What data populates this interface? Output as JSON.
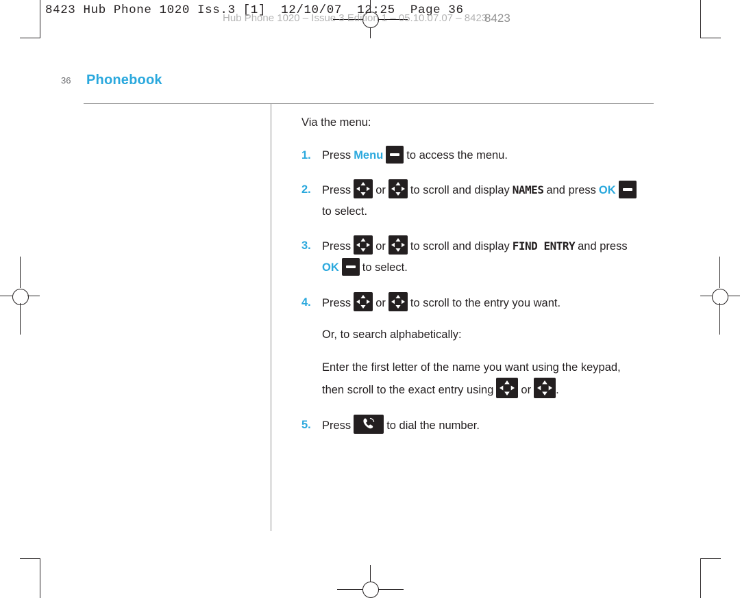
{
  "slug": {
    "text": "8423 Hub Phone 1020 Iss.3 [1]  12/10/07  12:25  Page 36"
  },
  "ghost": {
    "header": "Hub Phone 1020 – Issue 3 Edition 1 – 05.10.07.07 – 8423",
    "folio": "8423"
  },
  "page": {
    "number": "36",
    "chapter": "Phonebook"
  },
  "body": {
    "intro": "Via the menu:",
    "steps": [
      {
        "num": "1.",
        "before": "Press",
        "key_label": "Menu",
        "after": "to access the menu."
      },
      {
        "num": "2.",
        "before": "Press",
        "or": "or",
        "mid": "to scroll and display",
        "display": "NAMES",
        "and_press": "and press",
        "ok": "OK",
        "after": "to select."
      },
      {
        "num": "3.",
        "before": "Press",
        "or": "or",
        "mid": "to scroll and display",
        "display": "FIND ENTRY",
        "and_press": "and press",
        "ok": "OK",
        "after": "to select."
      },
      {
        "num": "4.",
        "before": "Press",
        "or": "or",
        "after": "to scroll to the entry you want."
      },
      {
        "num": "5.",
        "before": "Press",
        "after": "to dial the number."
      }
    ],
    "alt_intro": "Or, to search alphabetically:",
    "alt_line1": "Enter the first letter of the name you want using the keypad,",
    "alt_line2_before": "then scroll to the exact entry using",
    "alt_line2_or": "or",
    "alt_line2_end": "."
  },
  "icons": {
    "soft_key": "soft-key-icon",
    "nav_key": "navigation-key-icon",
    "call_key": "call-handset-key-icon"
  },
  "colors": {
    "accent": "#2aa8dd",
    "text": "#231f20",
    "rule": "#8c8c8c",
    "key": "#231f20"
  }
}
